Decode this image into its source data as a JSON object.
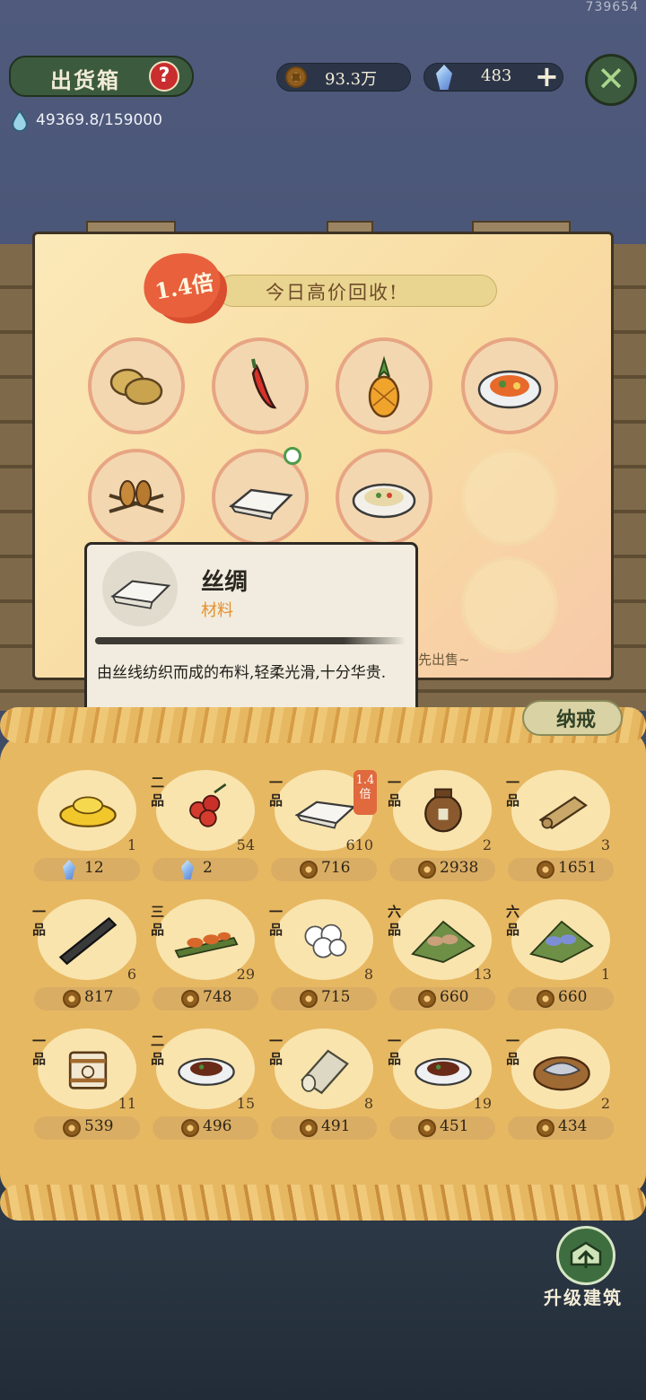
{
  "corner_id": "739654",
  "header": {
    "title": "出货箱",
    "help_symbol": "?",
    "capacity": "49369.8/159000",
    "coins": "93.3万",
    "gems": "483",
    "add_symbol": "+",
    "close_symbol": "✕"
  },
  "board": {
    "multiplier": "1.4倍",
    "banner": "今日高价回收!",
    "hint": "先出售~",
    "slots": [
      {
        "name": "potato-icon"
      },
      {
        "name": "chili-pepper-icon"
      },
      {
        "name": "pineapple-icon"
      },
      {
        "name": "stir-fry-dish-icon"
      },
      {
        "name": "grilled-skewers-icon"
      },
      {
        "name": "silk-cloth-icon"
      },
      {
        "name": "noodle-salad-plate-icon"
      },
      {
        "name": "empty-slot"
      }
    ]
  },
  "tooltip": {
    "title": "丝绸",
    "category": "材料",
    "description": "由丝线纺织而成的布料,轻柔光滑,十分华贵."
  },
  "storage": {
    "tab_label": "纳戒",
    "multiplier_badge": "1.4倍",
    "items": [
      {
        "icon": "gold-ingot-icon",
        "grade": "",
        "qty": "1",
        "currency": "gem",
        "price": "12"
      },
      {
        "icon": "red-berries-icon",
        "grade": "二品",
        "qty": "54",
        "currency": "gem",
        "price": "2"
      },
      {
        "icon": "silk-cloth-icon",
        "grade": "一品",
        "qty": "610",
        "currency": "coin",
        "price": "716"
      },
      {
        "icon": "clay-jar-icon",
        "grade": "一品",
        "qty": "2",
        "currency": "coin",
        "price": "2938"
      },
      {
        "icon": "rolled-scroll-icon",
        "grade": "一品",
        "qty": "3",
        "currency": "coin",
        "price": "1651"
      },
      {
        "icon": "ink-stick-icon",
        "grade": "一品",
        "qty": "6",
        "currency": "coin",
        "price": "817"
      },
      {
        "icon": "grilled-shrimp-icon",
        "grade": "三品",
        "qty": "29",
        "currency": "coin",
        "price": "748"
      },
      {
        "icon": "cotton-icon",
        "grade": "一品",
        "qty": "8",
        "currency": "coin",
        "price": "715"
      },
      {
        "icon": "shrimp-leaf-icon",
        "grade": "六品",
        "qty": "13",
        "currency": "coin",
        "price": "660"
      },
      {
        "icon": "blue-shrimp-leaf-icon",
        "grade": "六品",
        "qty": "1",
        "currency": "coin",
        "price": "660"
      },
      {
        "icon": "milk-bucket-icon",
        "grade": "一品",
        "qty": "11",
        "currency": "coin",
        "price": "539"
      },
      {
        "icon": "braised-dish-icon",
        "grade": "二品",
        "qty": "15",
        "currency": "coin",
        "price": "496"
      },
      {
        "icon": "linen-roll-icon",
        "grade": "一品",
        "qty": "8",
        "currency": "coin",
        "price": "491"
      },
      {
        "icon": "braised-dish-icon",
        "grade": "一品",
        "qty": "19",
        "currency": "coin",
        "price": "451"
      },
      {
        "icon": "fish-slice-board-icon",
        "grade": "一品",
        "qty": "2",
        "currency": "coin",
        "price": "434"
      }
    ]
  },
  "footer": {
    "upgrade_label": "升级建筑"
  },
  "colors": {
    "sky": "#4f5a7c",
    "board": "#f8dca2",
    "straw": "#e7b862",
    "accent_red": "#e8603c",
    "green_button": "#3c5a3e"
  }
}
